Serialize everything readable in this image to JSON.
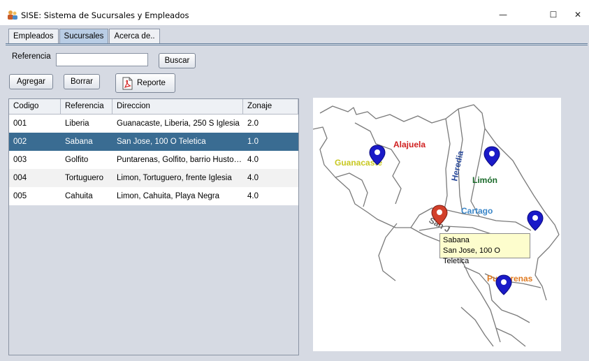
{
  "window": {
    "title": "SISE: Sistema de Sucursales y Empleados",
    "minimize_glyph": "—",
    "maximize_glyph": "☐",
    "close_glyph": "✕"
  },
  "tabs": [
    {
      "label": "Empleados",
      "active": false
    },
    {
      "label": "Sucursales",
      "active": true
    },
    {
      "label": "Acerca de..",
      "active": false
    }
  ],
  "search": {
    "label": "Referencia",
    "value": "",
    "button": "Buscar"
  },
  "toolbar": {
    "add": "Agregar",
    "delete": "Borrar",
    "report": "Reporte"
  },
  "table": {
    "columns": [
      "Codigo",
      "Referencia",
      "Direccion",
      "Zonaje"
    ],
    "rows": [
      {
        "codigo": "001",
        "referencia": "Liberia",
        "direccion": "Guanacaste, Liberia, 250 S Iglesia",
        "zonaje": "2.0"
      },
      {
        "codigo": "002",
        "referencia": "Sabana",
        "direccion": "San Jose, 100 O Teletica",
        "zonaje": "1.0"
      },
      {
        "codigo": "003",
        "referencia": "Golfito",
        "direccion": "Puntarenas, Golfito, barrio Huston...",
        "zonaje": "4.0"
      },
      {
        "codigo": "004",
        "referencia": "Tortuguero",
        "direccion": "Limon, Tortuguero, frente Iglesia",
        "zonaje": "4.0"
      },
      {
        "codigo": "005",
        "referencia": "Cahuita",
        "direccion": "Limon, Cahuita,  Playa Negra",
        "zonaje": "4.0"
      }
    ],
    "selected_index": 1
  },
  "map": {
    "regions": [
      "Alajuela",
      "Heredia",
      "Guanacaste",
      "Limón",
      "Cartago",
      "San J",
      "Puntarenas"
    ],
    "region_colors": {
      "Alajuela": "#d02020",
      "Heredia": "#2a4a9a",
      "Guanacaste": "#c8c820",
      "Limón": "#1a6a2a",
      "Cartago": "#3a86c8",
      "San J": "#666666",
      "Puntarenas": "#e07a20"
    },
    "marker_colors": {
      "default": "#1a1ac8",
      "selected": "#d2402a"
    },
    "tooltip": {
      "line1": "Sabana",
      "line2": "San Jose, 100 O Teletica"
    }
  }
}
